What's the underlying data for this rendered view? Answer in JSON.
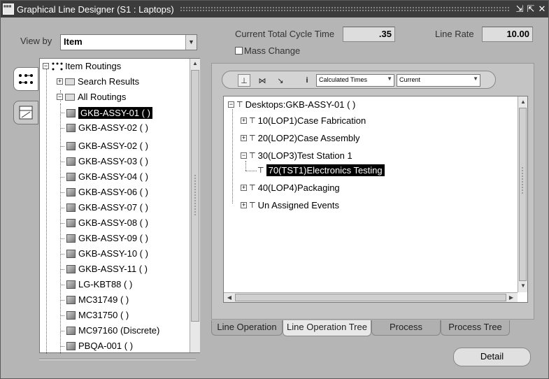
{
  "window": {
    "title": "Graphical Line Designer (S1 : Laptops)",
    "buttons": [
      "minimize",
      "maximize",
      "close"
    ]
  },
  "view_by": {
    "label": "View by",
    "value": "Item"
  },
  "cycle_time": {
    "label": "Current Total Cycle Time",
    "value": ".35"
  },
  "line_rate": {
    "label": "Line Rate",
    "value": "10.00"
  },
  "mass_change": {
    "label": "Mass Change",
    "checked": false
  },
  "left_tree": {
    "root": "Item Routings",
    "search_results": "Search Results",
    "all_routings": "All Routings",
    "items": [
      "GKB-ASSY-01 ( )",
      "GKB-ASSY-02 ( )",
      "GKB-ASSY-02 ( )",
      "GKB-ASSY-03 ( )",
      "GKB-ASSY-04 ( )",
      "GKB-ASSY-06 ( )",
      "GKB-ASSY-07 ( )",
      "GKB-ASSY-08 ( )",
      "GKB-ASSY-09 ( )",
      "GKB-ASSY-10 ( )",
      "GKB-ASSY-11 ( )",
      "LG-KBT88 ( )",
      "MC31749 ( )",
      "MC31750 ( )",
      "MC97160 (Discrete)",
      "PBQA-001 ( )"
    ],
    "selected_index": 0
  },
  "toolbar": {
    "times_select": "Calculated Times",
    "version_select": "Current"
  },
  "right_tree": {
    "root": "Desktops:GKB-ASSY-01 ( )",
    "nodes": [
      "10(LOP1)Case Fabrication",
      "20(LOP2)Case Assembly",
      "30(LOP3)Test Station 1",
      "70(TST1)Electronics Testing",
      "40(LOP4)Packaging",
      "Un Assigned Events"
    ]
  },
  "tabs": [
    "Line Operation",
    "Line Operation Tree",
    "Process",
    "Process Tree"
  ],
  "active_tab": "Line Operation Tree",
  "detail_button": "Detail"
}
